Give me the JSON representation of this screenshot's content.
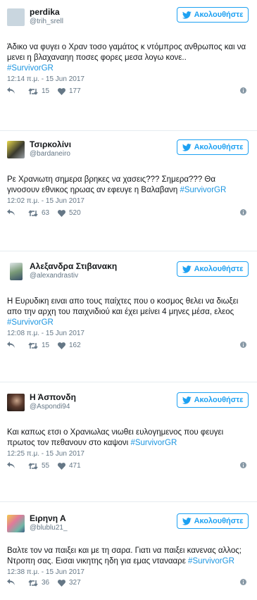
{
  "follow_label": "Ακολουθήστε",
  "tweets": [
    {
      "name": "perdika",
      "handle": "@trih_srell",
      "text_lines": [
        "Άδικο να φυγει ο Χραν τοσο γαμάτος κ ντόμπρος ανθρωπος και να μενει η βλαχαναηη ποσες φορες μεσα λογω κονε.."
      ],
      "hashtag": "#SurvivorGR",
      "timestamp": "12:14 π.μ. - 15 Jun 2017",
      "retweets": "15",
      "likes": "177"
    },
    {
      "name": "Τσιρκολίνι",
      "handle": "@bardaneiro",
      "text_lines": [
        "Ρε Χρανιωτη σημερα βρηκες να χασεις??? Σημερα??? Θα γινοσουν εθνικος ηρωας αν εφευγε η Βαλαβανη "
      ],
      "hashtag": "#SurvivorGR",
      "timestamp": "12:02 π.μ. - 15 Jun 2017",
      "retweets": "63",
      "likes": "520"
    },
    {
      "name": "Αλεξανδρα Στιβανακη",
      "handle": "@alexandrastiv",
      "text_lines": [
        "Η Ευρυδικη ειναι απο τους παίχτες που ο κοσμος θελει να διωξει απο την αρχη του παιχνιδιού και έχει μείνει 4 μηνες μέσα, ελεος "
      ],
      "hashtag": "#SurvivorGR",
      "timestamp": "12:08 π.μ. - 15 Jun 2017",
      "retweets": "15",
      "likes": "162"
    },
    {
      "name": "Η Άσπονδη",
      "handle": "@Aspondi94",
      "text_lines": [
        "Και καπως ετσι ο Χρανιωλας νιωθει ευλογημενος που φευγει πρωτος τον πεθανουν στο καψονι "
      ],
      "hashtag": "#SurvivorGR",
      "timestamp": "12:25 π.μ. - 15 Jun 2017",
      "retweets": "55",
      "likes": "471"
    },
    {
      "name": "Ειρηνη Α",
      "handle": "@blublu21_",
      "text_lines": [
        "Βαλτε τον να παιξει και με τη σαρα. Γιατι να παιξει κανενας αλλος; Ντροπη σας. Εισαι νικητης ηδη για εμας ντανααρε "
      ],
      "hashtag": "#SurvivorGR",
      "timestamp": "12:38 π.μ. - 15 Jun 2017",
      "retweets": "36",
      "likes": "327"
    }
  ],
  "colors": {
    "accent": "#1da1f2",
    "hashtag": "#1b95e0",
    "muted": "#657786",
    "divider": "#e6ecf0"
  }
}
